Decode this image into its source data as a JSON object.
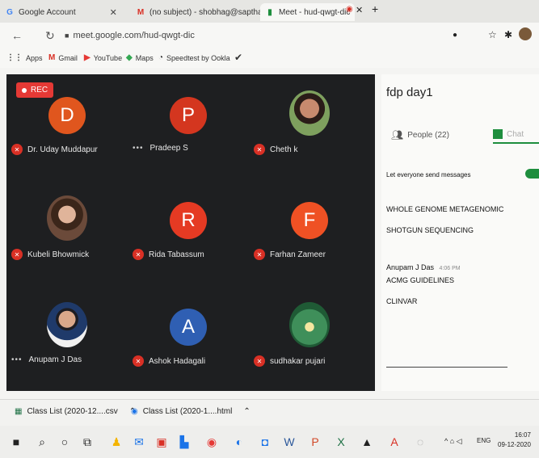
{
  "tabs": [
    {
      "label": "Google Account",
      "icon": "google-g-icon"
    },
    {
      "label": "(no subject) - shobhag@saptha",
      "icon": "gmail-icon"
    },
    {
      "label": "Meet - hud-qwgt-dic",
      "icon": "meet-icon"
    }
  ],
  "address": {
    "url": "meet.google.com/hud-qwgt-dic"
  },
  "bookmarks": [
    {
      "label": "Apps"
    },
    {
      "label": "Gmail"
    },
    {
      "label": "YouTube"
    },
    {
      "label": "Maps"
    },
    {
      "label": "Speedtest by Ookla"
    }
  ],
  "meet": {
    "rec_label": "REC",
    "participants": [
      {
        "name": "Dr. Uday Muddapur",
        "initial": "D",
        "color": "#e0561e",
        "muted": true
      },
      {
        "name": "Pradeep S",
        "initial": "P",
        "color": "#d4361f",
        "muted": false
      },
      {
        "name": "Cheth k",
        "initial": "",
        "color": "#5a7c45",
        "muted": true
      },
      {
        "name": "Kubeli Bhowmick",
        "initial": "",
        "color": "#8a6d5a",
        "muted": true
      },
      {
        "name": "Rida Tabassum",
        "initial": "R",
        "color": "#e53a23",
        "muted": true
      },
      {
        "name": "Farhan Zameer",
        "initial": "F",
        "color": "#ef5124",
        "muted": true
      },
      {
        "name": "Anupam J Das",
        "initial": "",
        "color": "#dcdcdc",
        "muted": false
      },
      {
        "name": "Ashok Hadagali",
        "initial": "A",
        "color": "#2f5fb3",
        "muted": false
      },
      {
        "name": "sudhakar pujari",
        "initial": "",
        "color": "#2e7d4f",
        "muted": true
      }
    ]
  },
  "panel": {
    "title": "fdp day1",
    "people_tab": "People (22)",
    "chat_tab": "Chat",
    "setting": "Let everyone send messages",
    "messages": [
      {
        "text": "WHOLE GENOME METAGENOMIC"
      },
      {
        "text": "SHOTGUN SEQUENCING"
      },
      {
        "sender": "Anupam J Das",
        "time": "4:06 PM"
      },
      {
        "text": "ACMG GUIDELINES"
      },
      {
        "text": "CLINVAR"
      }
    ]
  },
  "downloads": [
    {
      "label": "Class List (2020-12....csv"
    },
    {
      "label": "Class List (2020-1....html"
    }
  ],
  "tray": {
    "lang": "ENG",
    "time": "16:07",
    "date": "09-12-2020"
  }
}
